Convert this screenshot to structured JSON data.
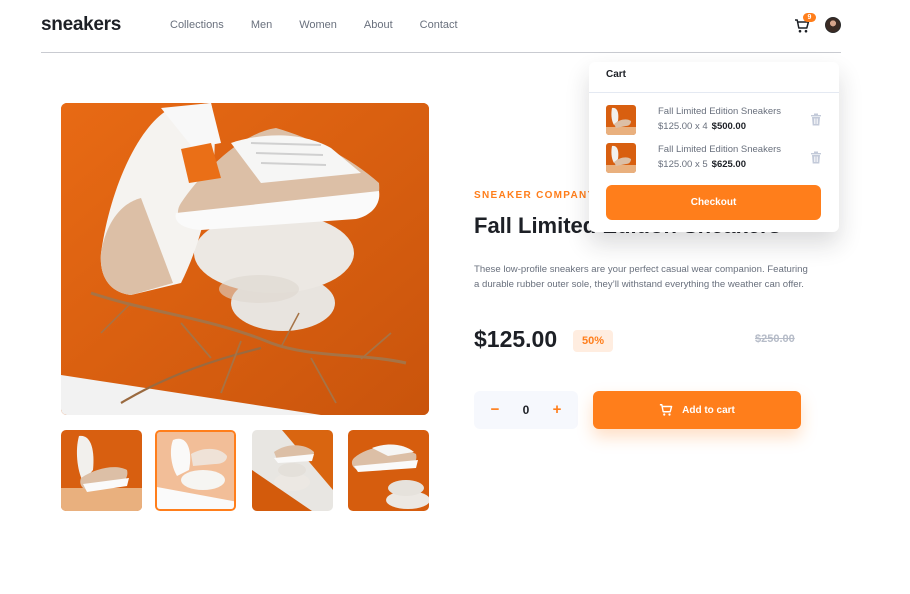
{
  "header": {
    "logo": "sneakers",
    "nav": [
      "Collections",
      "Men",
      "Women",
      "About",
      "Contact"
    ],
    "cart_count": "9"
  },
  "product": {
    "company": "SNEAKER COMPANY",
    "title": "Fall Limited Edition Sneakers",
    "description": "These low-profile sneakers are your perfect casual wear companion. Featuring a durable rubber outer sole, they’ll withstand everything the weather can offer.",
    "price": "$125.00",
    "discount": "50%",
    "old_price": "$250.00",
    "quantity": "0",
    "minus_label": "−",
    "plus_label": "+",
    "add_to_cart_label": "Add to cart"
  },
  "gallery": {
    "active_thumb": 2,
    "thumb_count": 4
  },
  "cart": {
    "title": "Cart",
    "items": [
      {
        "name": "Fall Limited Edition Sneakers",
        "calc": "$125.00 x 4",
        "total": "$500.00"
      },
      {
        "name": "Fall Limited Edition Sneakers",
        "calc": "$125.00 x 5",
        "total": "$625.00"
      }
    ],
    "checkout_label": "Checkout"
  },
  "colors": {
    "accent": "#ff7e1b",
    "accent_pale": "#ffede0",
    "text_dark": "#1d2026",
    "text_muted": "#69707d"
  },
  "icons": {
    "cart": "cart-icon",
    "delete": "trash-icon",
    "avatar": "avatar-image"
  }
}
